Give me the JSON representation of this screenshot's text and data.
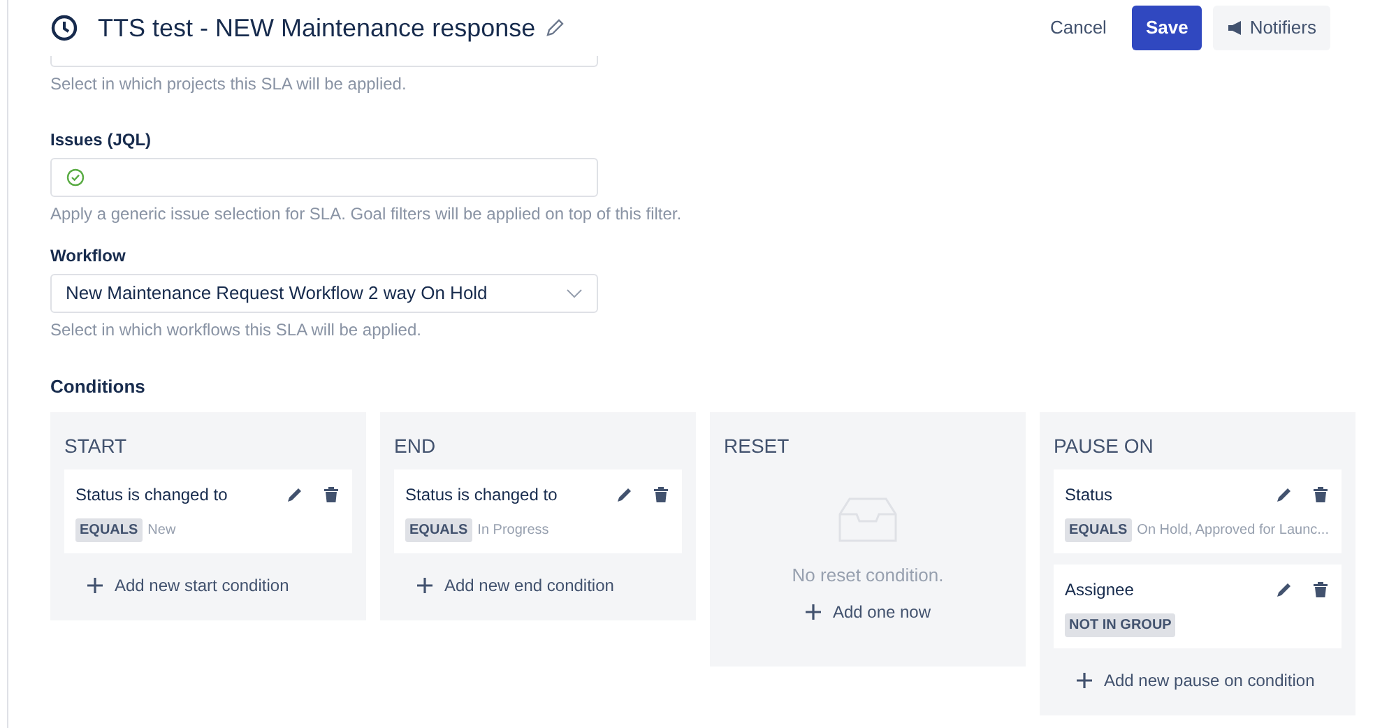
{
  "header": {
    "title": "TTS test - NEW Maintenance response",
    "buttons": [
      {
        "label": "Cancel",
        "kind": "link"
      },
      {
        "label": "Save",
        "kind": "primary"
      },
      {
        "label": "Notifiers",
        "kind": "secondary"
      }
    ]
  },
  "projects": {
    "hint": "Select in which projects this SLA will be applied."
  },
  "issues": {
    "label": "Issues (JQL)",
    "valid": true,
    "hint": "Apply a generic issue selection for SLA. Goal filters will be applied on top of this filter."
  },
  "workflow": {
    "label": "Workflow",
    "value": "New Maintenance Request Workflow 2 way On Hold",
    "hint": "Select in which workflows this SLA will be applied."
  },
  "conditions": {
    "title": "Conditions",
    "columns": [
      {
        "title": "START",
        "items": [
          {
            "label": "Status is changed to",
            "operator": "EQUALS",
            "value": "New"
          }
        ],
        "add_label": "Add new start condition"
      },
      {
        "title": "END",
        "items": [
          {
            "label": "Status is changed to",
            "operator": "EQUALS",
            "value": "In Progress"
          }
        ],
        "add_label": "Add new end condition"
      },
      {
        "title": "RESET",
        "empty_text": "No reset condition.",
        "add_label": "Add one now"
      },
      {
        "title": "PAUSE ON",
        "items": [
          {
            "label": "Status",
            "operator": "EQUALS",
            "value": "On Hold, Approved for Launc..."
          },
          {
            "label": "Assignee",
            "operator": "NOT IN GROUP"
          }
        ],
        "add_label": "Add new pause on condition"
      }
    ]
  }
}
